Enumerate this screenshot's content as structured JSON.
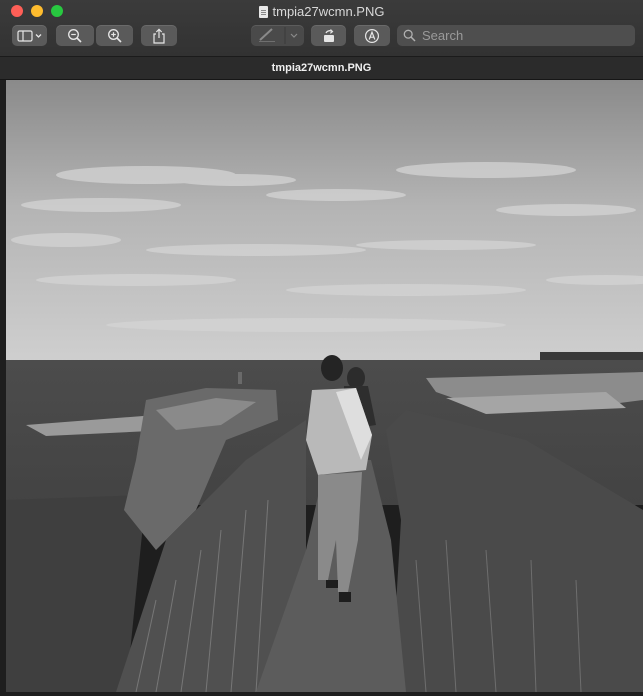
{
  "window": {
    "title": "tmpia27wcmn.PNG",
    "tab_label": "tmpia27wcmn.PNG"
  },
  "toolbar": {
    "sidebar_button": "sidebar-toggle-icon",
    "zoom_out": "zoom-out-icon",
    "zoom_in": "zoom-in-icon",
    "share": "share-icon",
    "markup_pen": "pen-icon",
    "rotate": "rotate-icon",
    "annotate": "markup-icon"
  },
  "search": {
    "placeholder": "Search",
    "value": ""
  },
  "image": {
    "description_icon": "photo-image"
  },
  "colors": {
    "close": "#fe5f57",
    "minimize": "#febc2e",
    "zoom": "#28c840"
  }
}
